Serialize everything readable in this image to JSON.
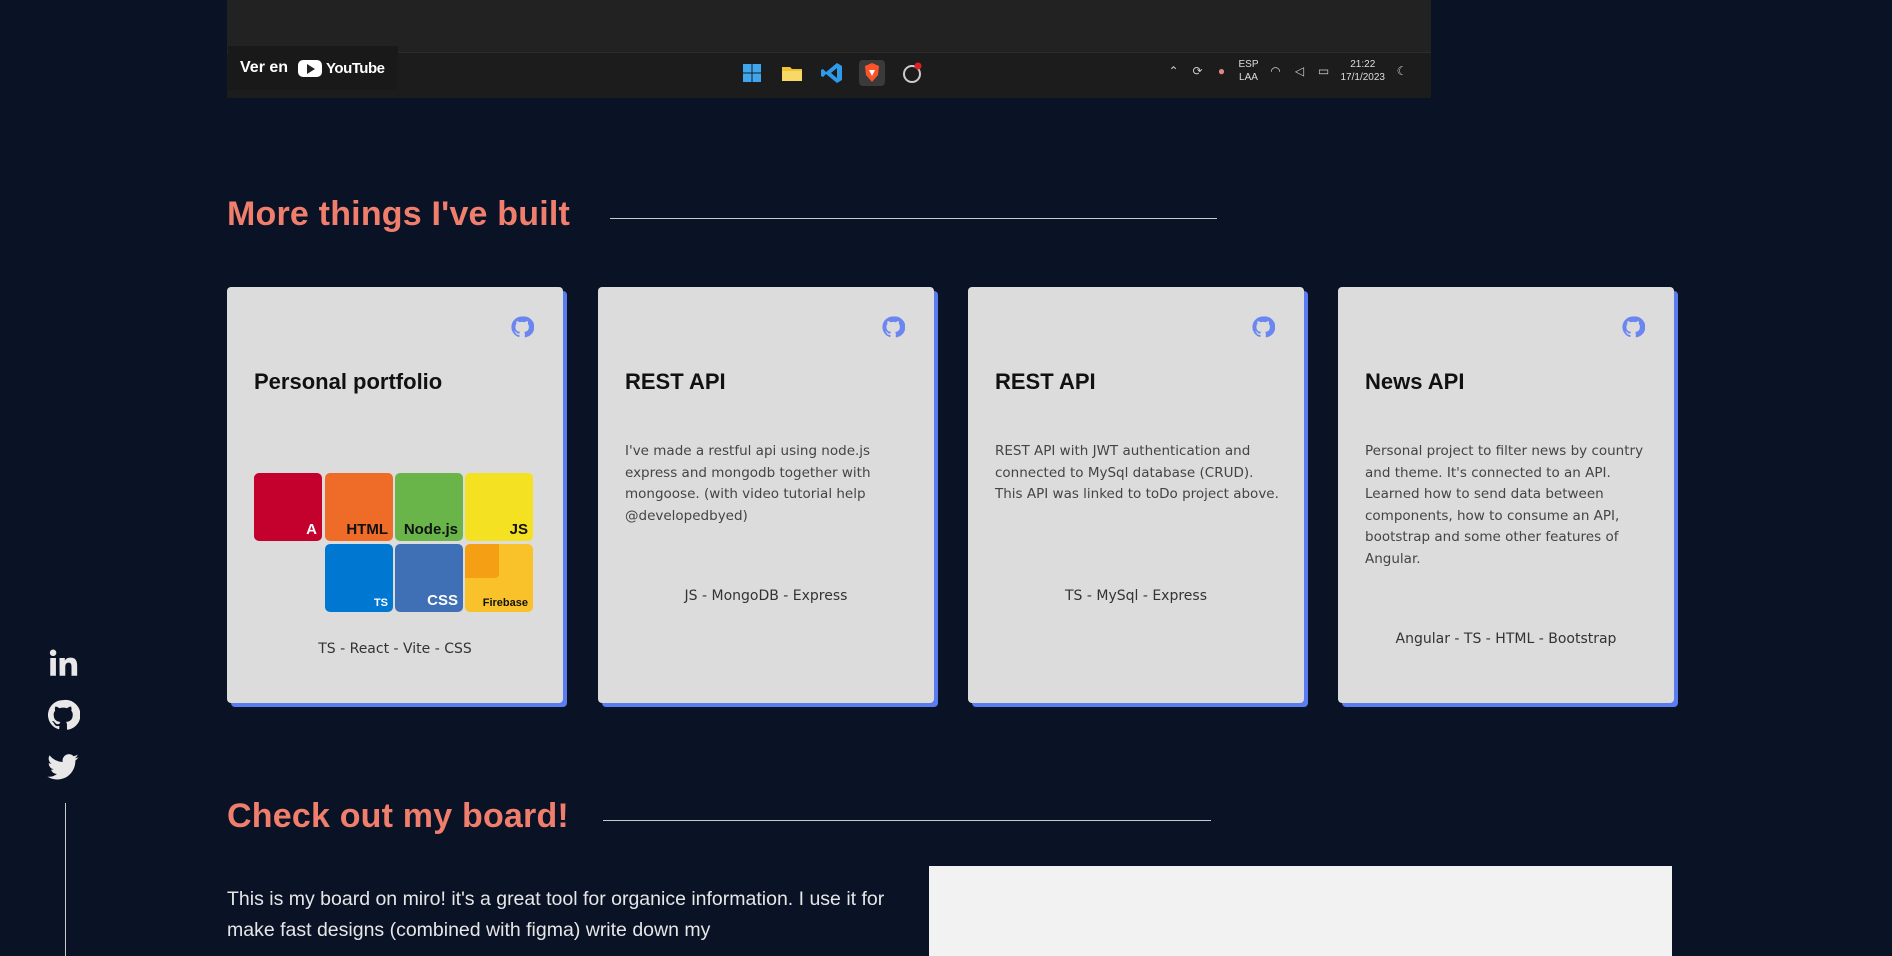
{
  "video": {
    "watch_on_label": "Ver en",
    "youtube_label": "YouTube",
    "tray": {
      "language_top": "ESP",
      "language_bottom": "LAA",
      "time": "21:22",
      "date": "17/1/2023"
    }
  },
  "projects_section": {
    "title": "More things I've built",
    "cards": [
      {
        "title": "Personal portfolio",
        "description": "",
        "tech": "TS - React - Vite - CSS",
        "tiles": [
          {
            "label": "A",
            "color": "#c4002c"
          },
          {
            "label": "HTML",
            "color": "#ee6b28"
          },
          {
            "label": "Node.js",
            "color": "#6ab54a"
          },
          {
            "label": "JS",
            "color": "#f4e121"
          },
          {
            "label": "TS",
            "color": "#0078d2"
          },
          {
            "label": "CSS",
            "color": "#3f6fb5"
          },
          {
            "label": "Firebase",
            "color": "#f9c22b"
          }
        ]
      },
      {
        "title": "REST API",
        "description": "I've made a restful api using node.js express and mongodb together with mongoose. (with video tutorial help @developedbyed)",
        "tech": "JS - MongoDB - Express"
      },
      {
        "title": "REST API",
        "description": "REST API with JWT authentication and connected to MySql database (CRUD). This API was linked to toDo project above.",
        "tech": "TS - MySql - Express"
      },
      {
        "title": "News API",
        "description": "Personal project to filter news by country and theme. It's connected to an API. Learned how to send data between components, how to consume an API, bootstrap and some other features of Angular.",
        "tech": "Angular - TS - HTML - Bootstrap"
      }
    ]
  },
  "board_section": {
    "title": "Check out my board!",
    "text": "This is my board on miro! it's a great tool for organice information. I use it for make fast designs (combined with figma) write down my"
  },
  "colors": {
    "background": "#0a1225",
    "accent": "#f07e6c",
    "card_bg": "#dcdcdc",
    "card_shadow": "#5b7cf0"
  }
}
